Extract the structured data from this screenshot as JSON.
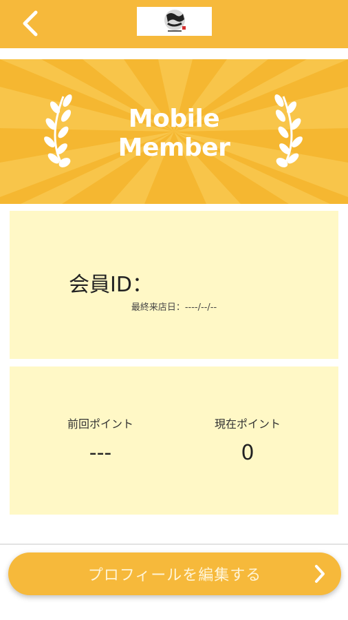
{
  "header": {
    "back_icon": "chevron-left-icon",
    "logo_alt": "store-logo"
  },
  "hero": {
    "title_line1": "Mobile",
    "title_line2": "Member",
    "accent": "#f5b731"
  },
  "member_card": {
    "id_label": "会員ID：",
    "last_visit_label": "最終来店日：",
    "last_visit_value": "----/--/--"
  },
  "points_card": {
    "previous_label": "前回ポイント",
    "previous_value": "---",
    "current_label": "現在ポイント",
    "current_value": "0"
  },
  "actions": {
    "edit_profile_label": "プロフィールを編集する",
    "edit_profile_icon": "chevron-right-icon"
  },
  "colors": {
    "topbar": "#f6b93b",
    "card_bg": "#fff8c6",
    "button": "#f6b93b"
  }
}
